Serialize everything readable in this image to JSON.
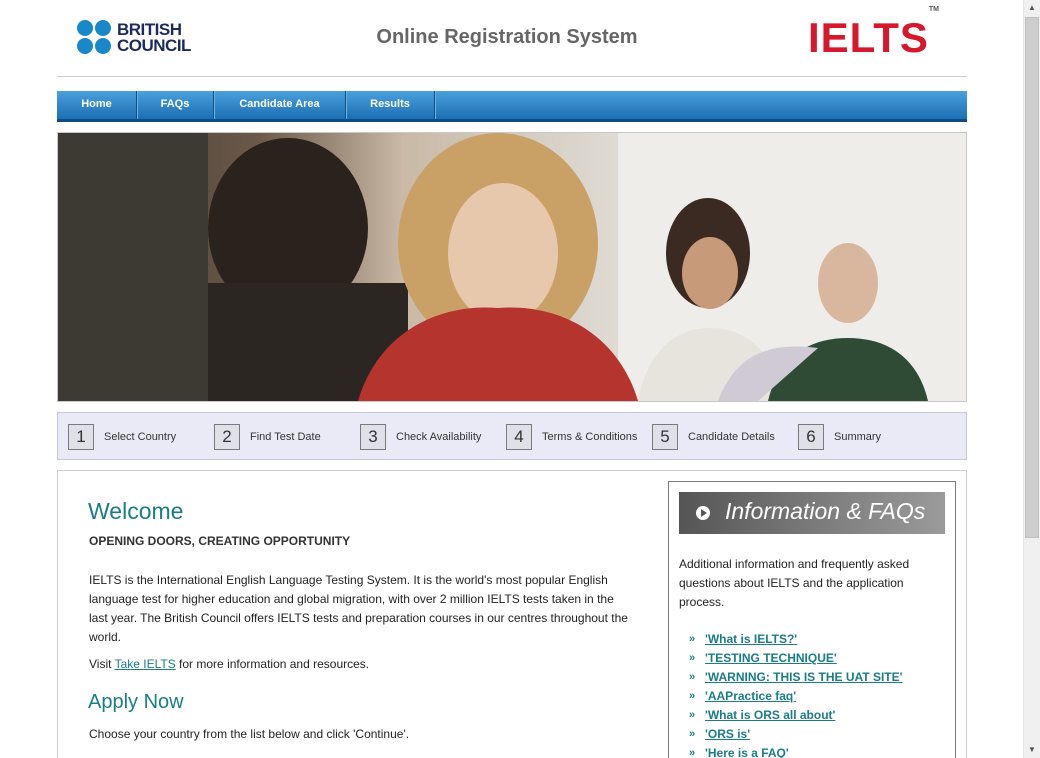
{
  "header": {
    "brand_left_line1": "BRITISH",
    "brand_left_line2": "COUNCIL",
    "site_title": "Online Registration System",
    "brand_right": "IELTS",
    "brand_right_tm": "TM"
  },
  "nav": {
    "items": [
      {
        "label": "Home"
      },
      {
        "label": "FAQs"
      },
      {
        "label": "Candidate Area"
      },
      {
        "label": "Results"
      }
    ]
  },
  "steps": [
    {
      "num": "1",
      "label": "Select Country"
    },
    {
      "num": "2",
      "label": "Find Test Date"
    },
    {
      "num": "3",
      "label": "Check Availability"
    },
    {
      "num": "4",
      "label": "Terms & Conditions"
    },
    {
      "num": "5",
      "label": "Candidate Details"
    },
    {
      "num": "6",
      "label": "Summary"
    }
  ],
  "main": {
    "welcome_title": "Welcome",
    "subtitle": "OPENING DOORS, CREATING OPPORTUNITY",
    "intro": "IELTS is the International English Language Testing System. It is the world's most popular English language test for higher education and global migration, with over 2 million IELTS tests taken in the last year. The British Council offers IELTS tests and preparation courses in our centres throughout the world.",
    "visit_prefix": "Visit ",
    "visit_link": "Take IELTS",
    "visit_suffix": " for more information and resources.",
    "apply_title": "Apply Now",
    "choose_text": "Choose your country from the list below and click 'Continue'."
  },
  "sidebar": {
    "title": "Information & FAQs",
    "description": "Additional information and frequently asked questions about IELTS and the application process.",
    "bullet": "»",
    "links": [
      {
        "label": "'What is IELTS?'"
      },
      {
        "label": "'TESTING TECHNIQUE'"
      },
      {
        "label": "'WARNING: THIS IS THE UAT SITE'"
      },
      {
        "label": "'AAPractice faq'"
      },
      {
        "label": "'What is ORS all about'"
      },
      {
        "label": "'ORS is'"
      },
      {
        "label": "'Here is a FAQ'"
      }
    ]
  },
  "colors": {
    "accent": "#1a7c86",
    "nav_blue": "#2a7fc4",
    "ielts_red": "#d5182b",
    "bc_blue": "#1a87c9"
  }
}
